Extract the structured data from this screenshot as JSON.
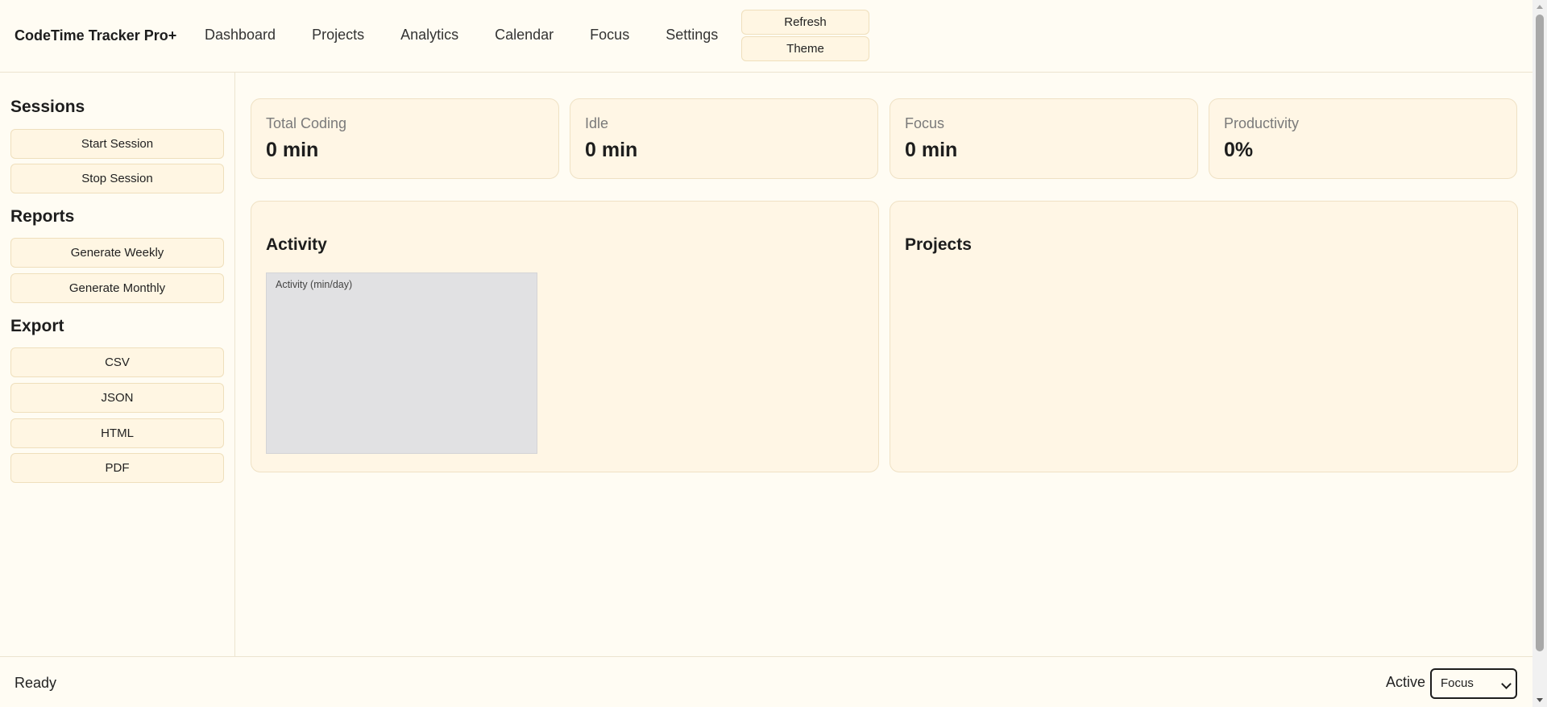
{
  "header": {
    "brand": "CodeTime Tracker Pro+",
    "nav": [
      "Dashboard",
      "Projects",
      "Analytics",
      "Calendar",
      "Focus",
      "Settings"
    ],
    "refresh_label": "Refresh",
    "theme_label": "Theme"
  },
  "sidebar": {
    "sessions_heading": "Sessions",
    "start_session": "Start Session",
    "stop_session": "Stop Session",
    "reports_heading": "Reports",
    "generate_weekly": "Generate Weekly",
    "generate_monthly": "Generate Monthly",
    "export_heading": "Export",
    "export_csv": "CSV",
    "export_json": "JSON",
    "export_html": "HTML",
    "export_pdf": "PDF"
  },
  "stats": [
    {
      "label": "Total Coding",
      "value": "0 min"
    },
    {
      "label": "Idle",
      "value": "0 min"
    },
    {
      "label": "Focus",
      "value": "0 min"
    },
    {
      "label": "Productivity",
      "value": "0%"
    }
  ],
  "activity_panel": {
    "title": "Activity",
    "chart_title": "Activity (min/day)"
  },
  "projects_panel": {
    "title": "Projects"
  },
  "statusbar": {
    "status": "Ready",
    "active_label": "Active",
    "active_value": "Focus"
  },
  "colors": {
    "background": "#fffcf3",
    "card": "#fff6e5",
    "button": "#fff6e3",
    "border": "#efdfbc",
    "chart_placeholder": "#e1e1e3"
  }
}
